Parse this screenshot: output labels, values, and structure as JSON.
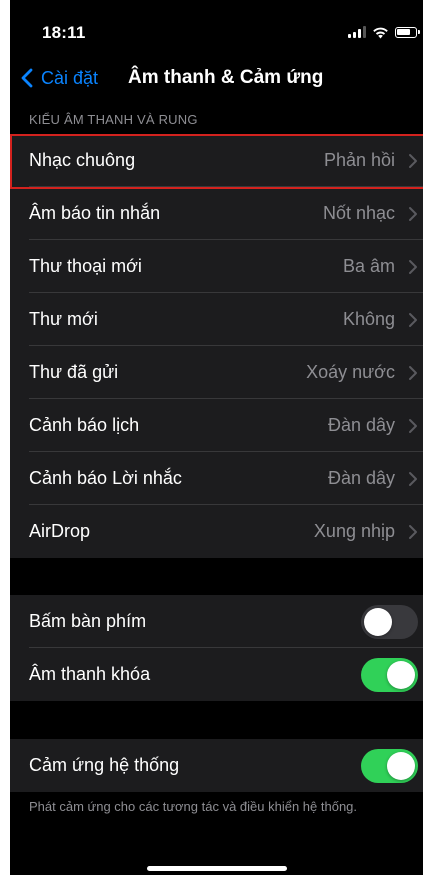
{
  "status_bar": {
    "time": "18:11",
    "signal_icon": "cellular-signal-icon",
    "wifi_icon": "wifi-icon",
    "battery_icon": "battery-icon"
  },
  "nav": {
    "back_label": "Cài đặt",
    "title": "Âm thanh & Cảm ứng"
  },
  "sounds_section": {
    "header": "KIỂU ÂM THANH VÀ RUNG",
    "rows": [
      {
        "label": "Nhạc chuông",
        "value": "Phản hồi",
        "highlighted": true
      },
      {
        "label": "Âm báo tin nhắn",
        "value": "Nốt nhạc"
      },
      {
        "label": "Thư thoại mới",
        "value": "Ba âm"
      },
      {
        "label": "Thư mới",
        "value": "Không"
      },
      {
        "label": "Thư đã gửi",
        "value": "Xoáy nước"
      },
      {
        "label": "Cảnh báo lịch",
        "value": "Đàn dây"
      },
      {
        "label": "Cảnh báo Lời nhắc",
        "value": "Đàn dây"
      },
      {
        "label": "AirDrop",
        "value": "Xung nhịp"
      }
    ]
  },
  "toggles": [
    {
      "label": "Bấm bàn phím",
      "on": false
    },
    {
      "label": "Âm thanh khóa",
      "on": true
    }
  ],
  "haptics": {
    "label": "Cảm ứng hệ thống",
    "on": true,
    "footer": "Phát cảm ứng cho các tương tác và điều khiển hệ thống."
  },
  "colors": {
    "accent": "#0a84ff",
    "toggle_on": "#30d158",
    "highlight": "#d3221e"
  }
}
